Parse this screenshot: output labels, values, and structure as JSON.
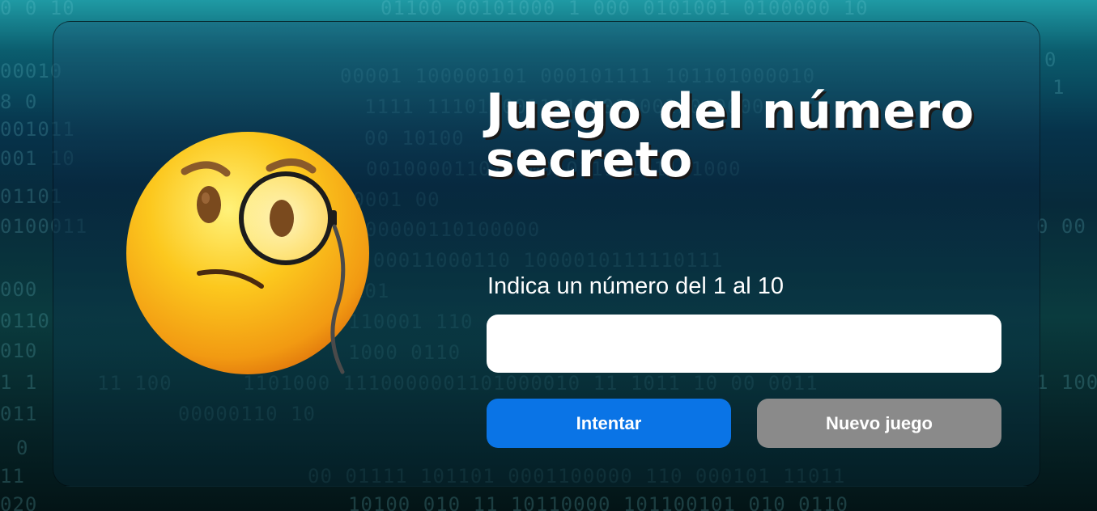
{
  "game": {
    "title": "Juego del número secreto",
    "instruction": "Indica un número del 1 al 10",
    "input": {
      "value": "",
      "placeholder": ""
    },
    "buttons": {
      "try_label": "Intentar",
      "new_game_label": "Nuevo juego"
    }
  },
  "colors": {
    "primary_button": "#0a74e6",
    "secondary_button": "#8a8a8a",
    "text": "#ffffff"
  },
  "icons": {
    "mascot": "face-with-monocle-icon"
  }
}
